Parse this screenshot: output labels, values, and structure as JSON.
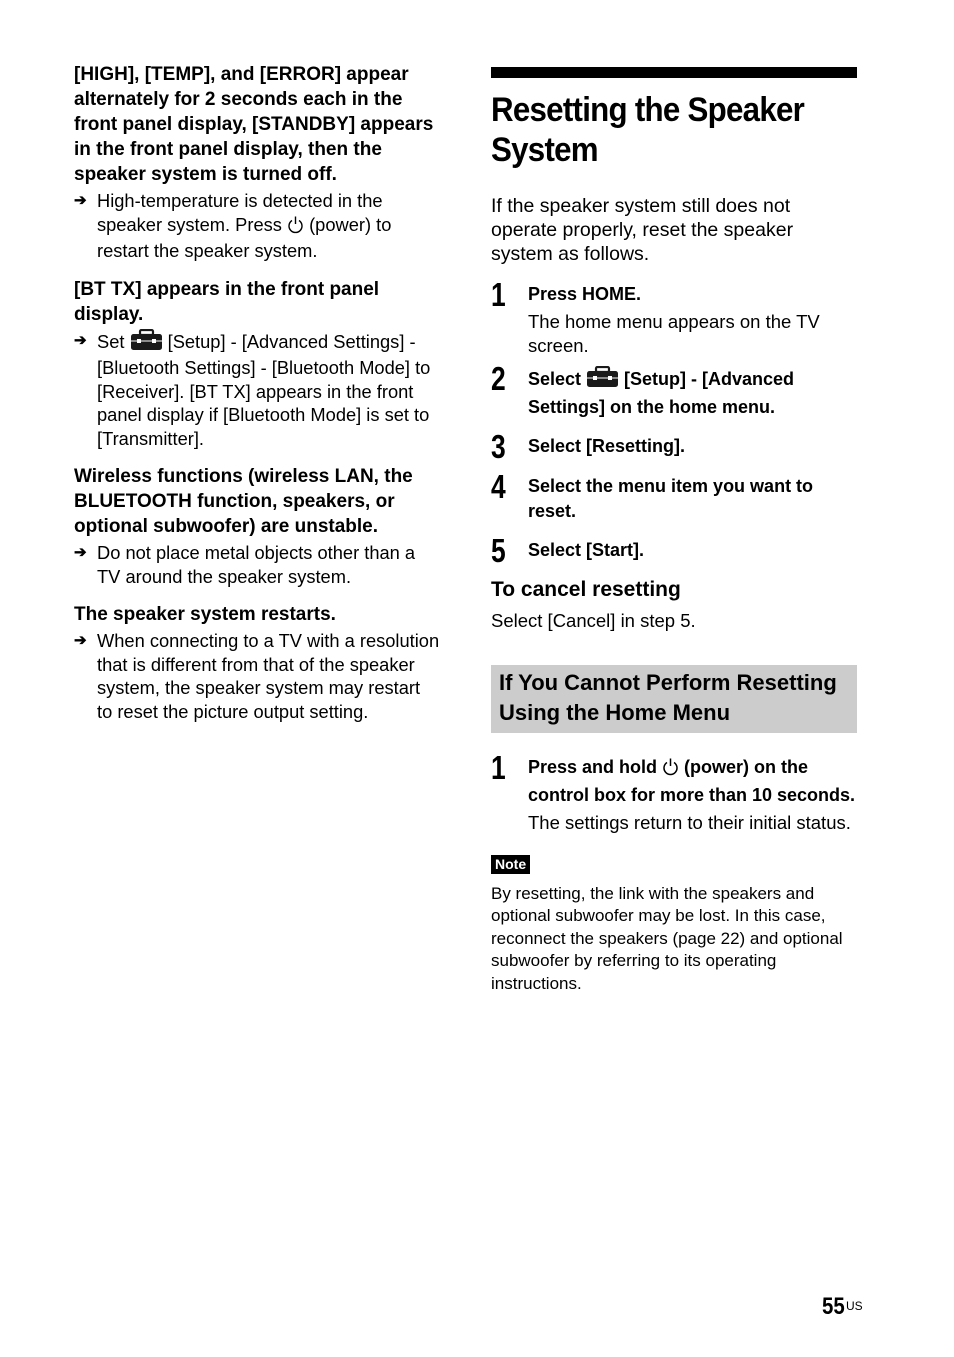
{
  "left": {
    "sections": [
      {
        "heading": "[HIGH], [TEMP], and [ERROR] appear alternately for 2 seconds each in the front panel display, [STANDBY] appears in the front panel display, then the speaker system is turned off.",
        "bullet_pre": "High-temperature is detected in the speaker system. Press ",
        "bullet_icon": "power-icon",
        "bullet_post": " (power) to restart the speaker system."
      },
      {
        "heading": "[BT TX] appears in the front panel display.",
        "bullet_pre": "Set ",
        "bullet_icon": "toolbox-icon",
        "bullet_post": " [Setup] - [Advanced Settings] - [Bluetooth Settings] - [Bluetooth Mode] to [Receiver]. [BT TX] appears in the front panel display if [Bluetooth Mode] is set to [Transmitter]."
      },
      {
        "heading": "Wireless functions (wireless LAN, the BLUETOOTH function, speakers, or optional subwoofer) are unstable.",
        "bullet": "Do not place metal objects other than a TV around the speaker system."
      },
      {
        "heading": "The speaker system restarts.",
        "bullet": "When connecting to a TV with a resolution that is different from that of the speaker system, the speaker system may restart to reset the picture output setting."
      }
    ],
    "arrow_glyph": "➔"
  },
  "right": {
    "title": "Resetting the Speaker System",
    "intro": "If the speaker system still does not operate properly, reset the speaker system as follows.",
    "steps": [
      {
        "num": "1",
        "text": "Press HOME.",
        "desc": "The home menu appears on the TV screen."
      },
      {
        "num": "2",
        "text_pre": "Select ",
        "icon": "toolbox-icon",
        "text_post": " [Setup] - [Advanced Settings] on the home menu."
      },
      {
        "num": "3",
        "text": "Select [Resetting]."
      },
      {
        "num": "4",
        "text": "Select the menu item you want to reset."
      },
      {
        "num": "5",
        "text": "Select [Start]."
      }
    ],
    "cancel": {
      "heading": "To cancel resetting",
      "text": "Select [Cancel] in step 5."
    },
    "band_heading": "If You Cannot Perform Resetting Using the Home Menu",
    "hold_step": {
      "num": "1",
      "text_pre": "Press and hold ",
      "icon": "power-icon",
      "text_post": " (power) on the control box for more than 10 seconds.",
      "desc": "The settings return to their initial status."
    },
    "note": {
      "label": "Note",
      "text": "By resetting, the link with the speakers and optional subwoofer may be lost. In this case, reconnect the speakers (page 22) and optional subwoofer by referring to its operating instructions."
    }
  },
  "footer": {
    "page_number": "55",
    "region": "US"
  }
}
